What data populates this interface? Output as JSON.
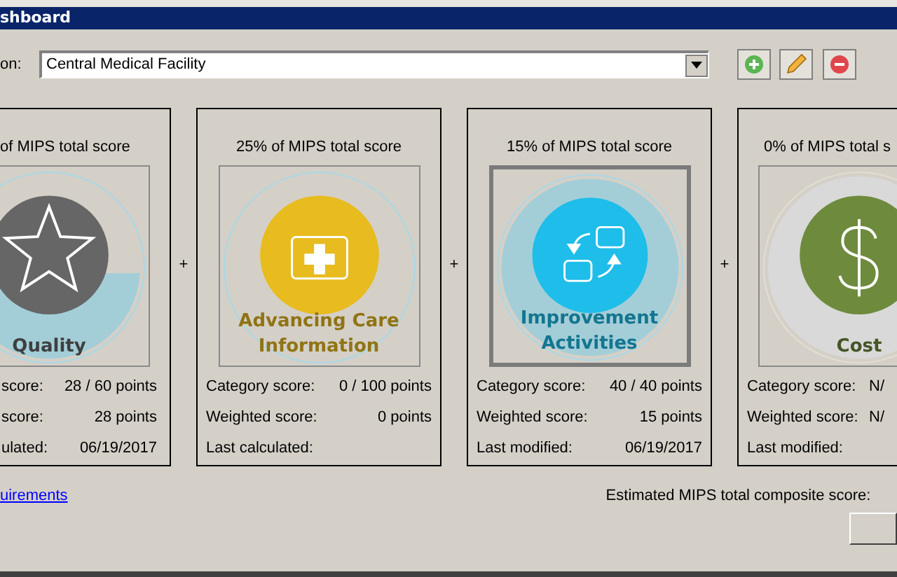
{
  "window": {
    "title": "shboard"
  },
  "location": {
    "label": "on:",
    "value": "Central Medical Facility"
  },
  "categories": [
    {
      "kind": "quality",
      "header": "of MIPS total score",
      "name": "Quality",
      "color": "#666666",
      "level": 0.47,
      "applicable": true,
      "selected": false,
      "rows": [
        {
          "label": "score:",
          "value": "28 / 60 points"
        },
        {
          "label": "score:",
          "value": "28 points"
        },
        {
          "label": "ulated:",
          "value": "06/19/2017"
        }
      ]
    },
    {
      "kind": "aci",
      "header": "25% of MIPS total score",
      "name": "Advancing Care Information",
      "color": "#e8bb1f",
      "applicable": true,
      "selected": false,
      "rows": [
        {
          "label": "Category score:",
          "value": "0 / 100 points"
        },
        {
          "label": "Weighted score:",
          "value": "0 points"
        },
        {
          "label": "Last calculated:",
          "value": ""
        }
      ]
    },
    {
      "kind": "improvement",
      "header": "15% of MIPS total score",
      "name": "Improvement Activities",
      "color": "#1fbde9",
      "level": 1,
      "applicable": true,
      "selected": true,
      "rows": [
        {
          "label": "Category score:",
          "value": "40 / 40 points"
        },
        {
          "label": "Weighted score:",
          "value": "15 points"
        },
        {
          "label": "Last modified:",
          "value": "06/19/2017"
        }
      ]
    },
    {
      "kind": "cost",
      "header": "0% of MIPS total s",
      "name": "Cost",
      "color": "#6e8b3d",
      "level": 1,
      "applicable": false,
      "selected": false,
      "rows": [
        {
          "label": "Category score:",
          "value": "N/"
        },
        {
          "label": "Weighted score:",
          "value": "N/"
        },
        {
          "label": "Last modified:",
          "value": ""
        }
      ]
    }
  ],
  "plus": [
    "+",
    "+",
    "+"
  ],
  "footer": {
    "link": "uirements",
    "composite_label": "Estimated MIPS total composite score:"
  }
}
